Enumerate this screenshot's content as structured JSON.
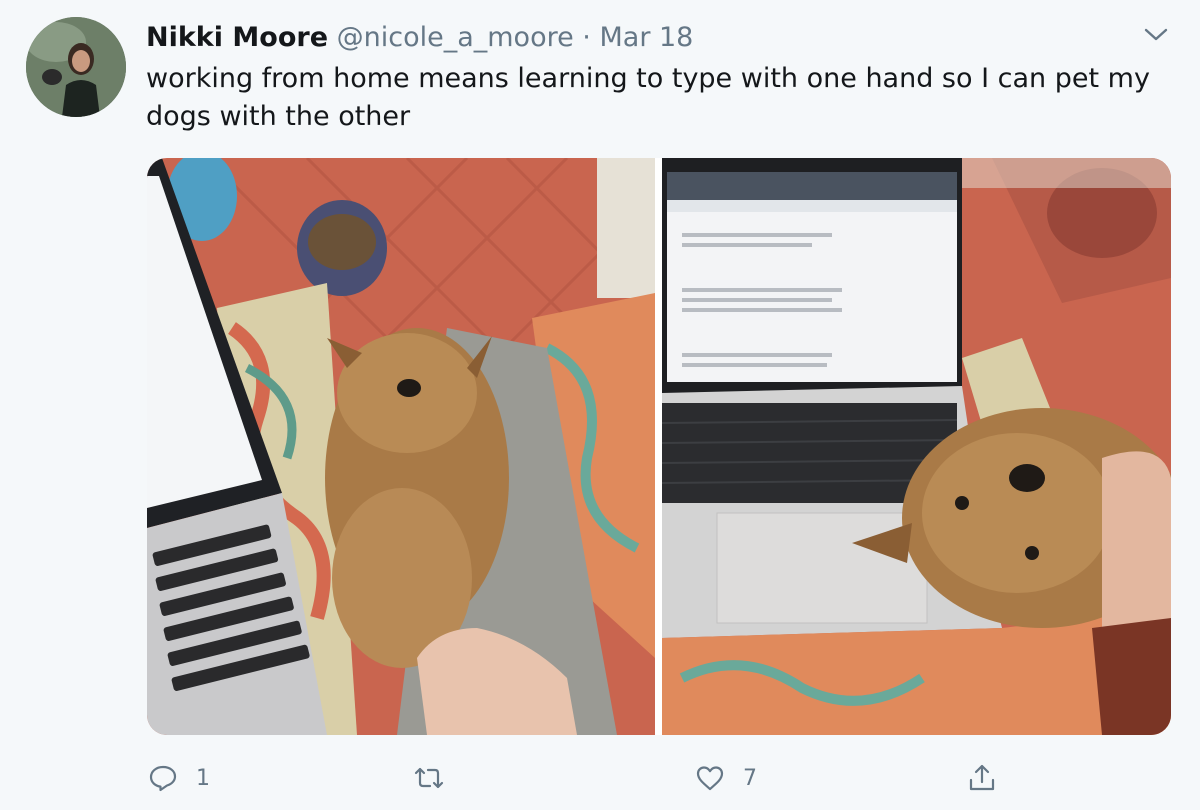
{
  "tweet": {
    "author_name": "Nikki Moore",
    "handle": "@nicole_a_moore",
    "separator": "·",
    "date": "Mar 18",
    "text": "working from home means learning to type with one hand so I can pet my dogs with the other"
  },
  "media": {
    "photos": [
      {
        "subject": "Yorkshire terrier lying belly-up on a pillow next to a laptop"
      },
      {
        "subject": "Yorkshire terrier lying upside down on a laptop trackpad"
      }
    ]
  },
  "actions": {
    "reply": {
      "icon": "reply-icon",
      "count": "1"
    },
    "retweet": {
      "icon": "retweet-icon",
      "count": ""
    },
    "like": {
      "icon": "heart-icon",
      "count": "7"
    },
    "share": {
      "icon": "share-icon",
      "count": ""
    }
  },
  "colors": {
    "background": "#f5f8fa",
    "text_primary": "#14171a",
    "text_secondary": "#657786"
  }
}
